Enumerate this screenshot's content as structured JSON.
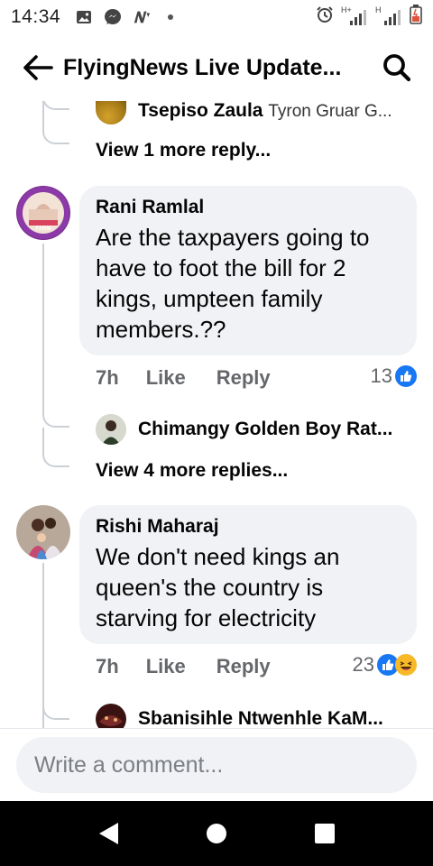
{
  "status_bar": {
    "time": "14:34",
    "network_label_1": "H+",
    "network_label_2": "H"
  },
  "header": {
    "title": "FlyingNews Live Update...",
    "back_icon": "back-arrow-icon",
    "search_icon": "search-icon"
  },
  "thread": {
    "top_reply": {
      "name": "Tsepiso Zaula",
      "snippet": "Tyron Gruar G..."
    },
    "top_more_replies": "View 1 more reply...",
    "comments": [
      {
        "author": "Rani Ramlal",
        "text": "Are the taxpayers going to have to foot the bill for 2 kings, umpteen family members.??",
        "time": "7h",
        "like_label": "Like",
        "reply_label": "Reply",
        "reaction_count": "13",
        "reactions": [
          "like"
        ],
        "reply_preview": {
          "name": "Chimangy Golden Boy Rat..."
        },
        "more_replies": "View 4 more replies..."
      },
      {
        "author": "Rishi Maharaj",
        "text": "We don't  need  kings  an queen's the  country is starving for electricity",
        "time": "7h",
        "like_label": "Like",
        "reply_label": "Reply",
        "reaction_count": "23",
        "reactions": [
          "like",
          "haha"
        ],
        "reply_preview": {
          "name": "Sbanisihle Ntwenhle KaM..."
        }
      }
    ]
  },
  "composer": {
    "placeholder": "Write a comment..."
  },
  "colors": {
    "like_blue": "#1877f2",
    "bubble_bg": "#f0f2f5",
    "meta_gray": "#65676b",
    "haha_yellow": "#f7b928"
  }
}
